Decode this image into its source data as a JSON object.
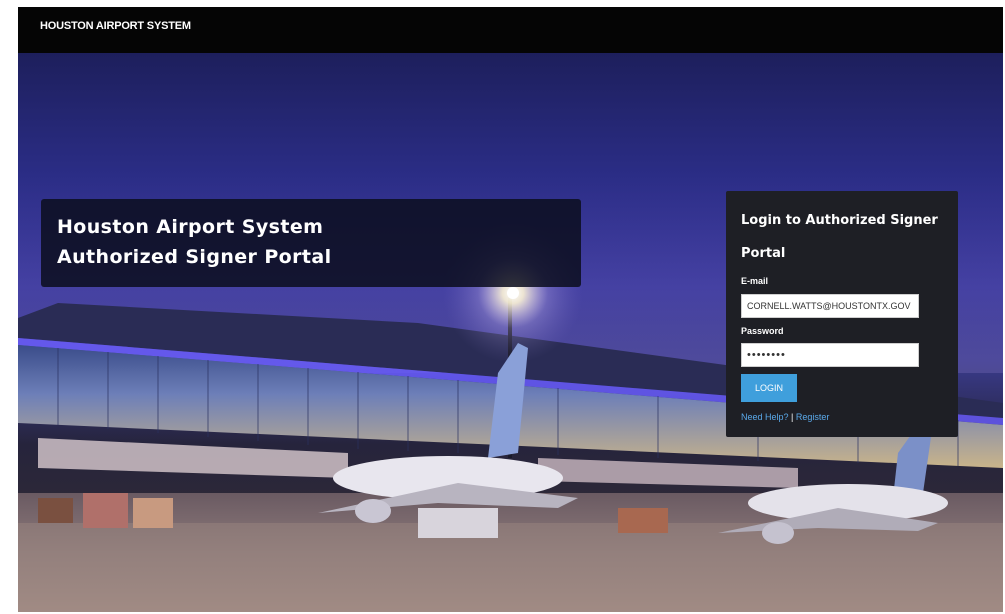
{
  "header": {
    "title": "HOUSTON AIRPORT SYSTEM"
  },
  "hero": {
    "title_line1": "Houston Airport System",
    "title_line2": "Authorized Signer Portal"
  },
  "login": {
    "heading": "Login to Authorized Signer Portal",
    "email_label": "E-mail",
    "email_value": "CORNELL.WATTS@HOUSTONTX.GOV",
    "password_label": "Password",
    "password_value": "password",
    "button_label": "LOGIN",
    "help_link": "Need Help?",
    "separator": "|",
    "register_link": "Register"
  },
  "colors": {
    "topbar": "#050505",
    "panel": "#1e1f25",
    "button": "#3f9fdc",
    "link": "#5aa9ea"
  }
}
